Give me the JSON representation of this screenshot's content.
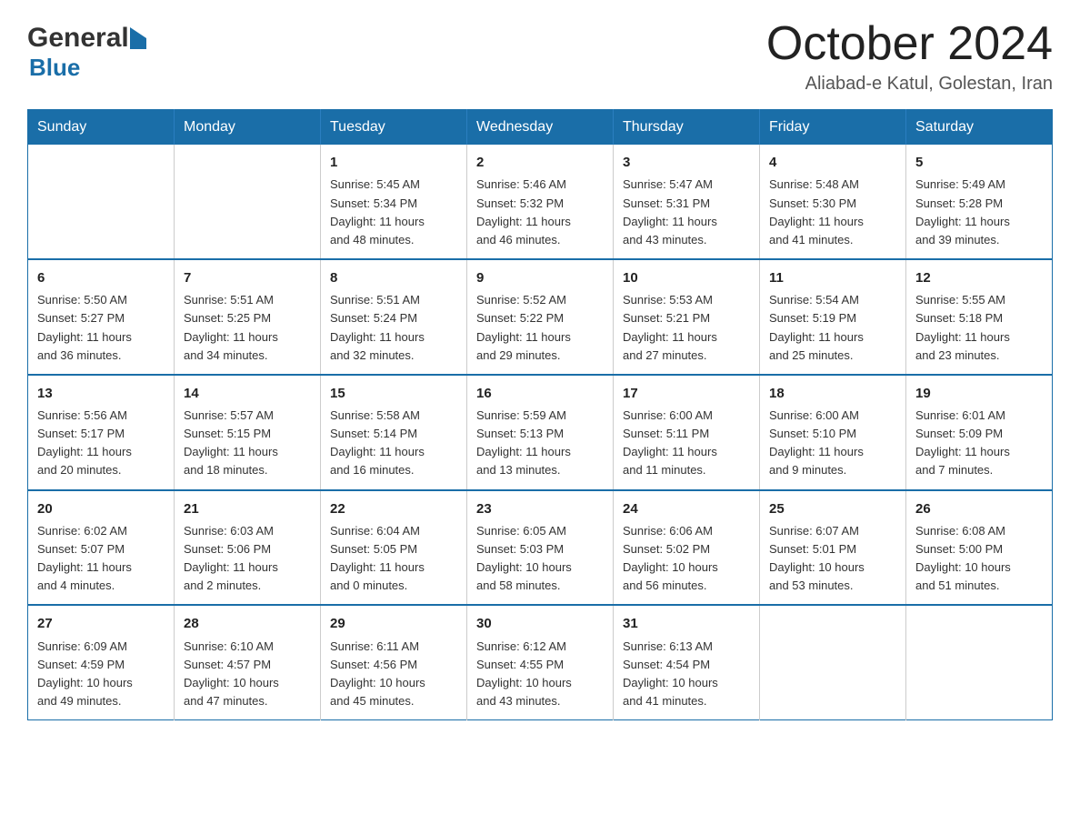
{
  "header": {
    "logo_general": "General",
    "logo_blue": "Blue",
    "month_title": "October 2024",
    "subtitle": "Aliabad-e Katul, Golestan, Iran"
  },
  "days_of_week": [
    "Sunday",
    "Monday",
    "Tuesday",
    "Wednesday",
    "Thursday",
    "Friday",
    "Saturday"
  ],
  "weeks": [
    [
      {
        "day": "",
        "info": ""
      },
      {
        "day": "",
        "info": ""
      },
      {
        "day": "1",
        "info": "Sunrise: 5:45 AM\nSunset: 5:34 PM\nDaylight: 11 hours\nand 48 minutes."
      },
      {
        "day": "2",
        "info": "Sunrise: 5:46 AM\nSunset: 5:32 PM\nDaylight: 11 hours\nand 46 minutes."
      },
      {
        "day": "3",
        "info": "Sunrise: 5:47 AM\nSunset: 5:31 PM\nDaylight: 11 hours\nand 43 minutes."
      },
      {
        "day": "4",
        "info": "Sunrise: 5:48 AM\nSunset: 5:30 PM\nDaylight: 11 hours\nand 41 minutes."
      },
      {
        "day": "5",
        "info": "Sunrise: 5:49 AM\nSunset: 5:28 PM\nDaylight: 11 hours\nand 39 minutes."
      }
    ],
    [
      {
        "day": "6",
        "info": "Sunrise: 5:50 AM\nSunset: 5:27 PM\nDaylight: 11 hours\nand 36 minutes."
      },
      {
        "day": "7",
        "info": "Sunrise: 5:51 AM\nSunset: 5:25 PM\nDaylight: 11 hours\nand 34 minutes."
      },
      {
        "day": "8",
        "info": "Sunrise: 5:51 AM\nSunset: 5:24 PM\nDaylight: 11 hours\nand 32 minutes."
      },
      {
        "day": "9",
        "info": "Sunrise: 5:52 AM\nSunset: 5:22 PM\nDaylight: 11 hours\nand 29 minutes."
      },
      {
        "day": "10",
        "info": "Sunrise: 5:53 AM\nSunset: 5:21 PM\nDaylight: 11 hours\nand 27 minutes."
      },
      {
        "day": "11",
        "info": "Sunrise: 5:54 AM\nSunset: 5:19 PM\nDaylight: 11 hours\nand 25 minutes."
      },
      {
        "day": "12",
        "info": "Sunrise: 5:55 AM\nSunset: 5:18 PM\nDaylight: 11 hours\nand 23 minutes."
      }
    ],
    [
      {
        "day": "13",
        "info": "Sunrise: 5:56 AM\nSunset: 5:17 PM\nDaylight: 11 hours\nand 20 minutes."
      },
      {
        "day": "14",
        "info": "Sunrise: 5:57 AM\nSunset: 5:15 PM\nDaylight: 11 hours\nand 18 minutes."
      },
      {
        "day": "15",
        "info": "Sunrise: 5:58 AM\nSunset: 5:14 PM\nDaylight: 11 hours\nand 16 minutes."
      },
      {
        "day": "16",
        "info": "Sunrise: 5:59 AM\nSunset: 5:13 PM\nDaylight: 11 hours\nand 13 minutes."
      },
      {
        "day": "17",
        "info": "Sunrise: 6:00 AM\nSunset: 5:11 PM\nDaylight: 11 hours\nand 11 minutes."
      },
      {
        "day": "18",
        "info": "Sunrise: 6:00 AM\nSunset: 5:10 PM\nDaylight: 11 hours\nand 9 minutes."
      },
      {
        "day": "19",
        "info": "Sunrise: 6:01 AM\nSunset: 5:09 PM\nDaylight: 11 hours\nand 7 minutes."
      }
    ],
    [
      {
        "day": "20",
        "info": "Sunrise: 6:02 AM\nSunset: 5:07 PM\nDaylight: 11 hours\nand 4 minutes."
      },
      {
        "day": "21",
        "info": "Sunrise: 6:03 AM\nSunset: 5:06 PM\nDaylight: 11 hours\nand 2 minutes."
      },
      {
        "day": "22",
        "info": "Sunrise: 6:04 AM\nSunset: 5:05 PM\nDaylight: 11 hours\nand 0 minutes."
      },
      {
        "day": "23",
        "info": "Sunrise: 6:05 AM\nSunset: 5:03 PM\nDaylight: 10 hours\nand 58 minutes."
      },
      {
        "day": "24",
        "info": "Sunrise: 6:06 AM\nSunset: 5:02 PM\nDaylight: 10 hours\nand 56 minutes."
      },
      {
        "day": "25",
        "info": "Sunrise: 6:07 AM\nSunset: 5:01 PM\nDaylight: 10 hours\nand 53 minutes."
      },
      {
        "day": "26",
        "info": "Sunrise: 6:08 AM\nSunset: 5:00 PM\nDaylight: 10 hours\nand 51 minutes."
      }
    ],
    [
      {
        "day": "27",
        "info": "Sunrise: 6:09 AM\nSunset: 4:59 PM\nDaylight: 10 hours\nand 49 minutes."
      },
      {
        "day": "28",
        "info": "Sunrise: 6:10 AM\nSunset: 4:57 PM\nDaylight: 10 hours\nand 47 minutes."
      },
      {
        "day": "29",
        "info": "Sunrise: 6:11 AM\nSunset: 4:56 PM\nDaylight: 10 hours\nand 45 minutes."
      },
      {
        "day": "30",
        "info": "Sunrise: 6:12 AM\nSunset: 4:55 PM\nDaylight: 10 hours\nand 43 minutes."
      },
      {
        "day": "31",
        "info": "Sunrise: 6:13 AM\nSunset: 4:54 PM\nDaylight: 10 hours\nand 41 minutes."
      },
      {
        "day": "",
        "info": ""
      },
      {
        "day": "",
        "info": ""
      }
    ]
  ]
}
